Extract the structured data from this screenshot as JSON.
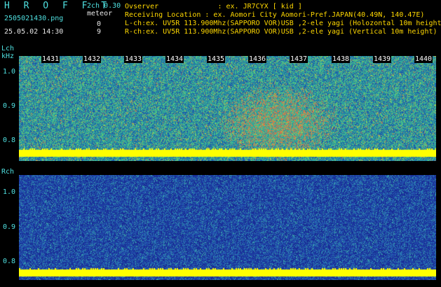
{
  "header": {
    "app_title": "H R O F F T",
    "channel": "2ch 0.30",
    "meteor_label": "meteor",
    "filename": "2505021430.png",
    "datetime": "25.05.02 14:30",
    "count_l": "0",
    "count_r": "9"
  },
  "info": {
    "observer": "Ovserver              : ex. JR7CYX [ kid ]",
    "location": "Receiving Location : ex. Aomori City Aomori-Pref.JAPAN(40.49N, 140.47E)",
    "lch": "L-ch:ex. UV5R 113.900Mhz(SAPPORO VOR)USB ,2-ele yagi (Holozontal 10m height",
    "rch": "R-ch:ex. UV5R 113.900Mhz(SAPPORO VOR)USB ,2-ele yagi (Vertical 10m height)"
  },
  "lch_panel": {
    "label": "Lch",
    "unit": "kHz",
    "yticks": [
      "1.0",
      "0.9",
      "0.8"
    ]
  },
  "rch_panel": {
    "label": "Rch",
    "yticks": [
      "1.0",
      "0.9",
      "0.8"
    ]
  },
  "time_labels": [
    "1431",
    "1432",
    "1433",
    "1434",
    "1435",
    "1436",
    "1437",
    "1438",
    "1439",
    "1440"
  ],
  "colors": {
    "cyan_text": "#4fe0e0",
    "yellow_text": "#ffd800",
    "lch_background": "#2a9aa0",
    "rch_background": "#1a3a9c",
    "carrier_band": "#ffff00"
  }
}
